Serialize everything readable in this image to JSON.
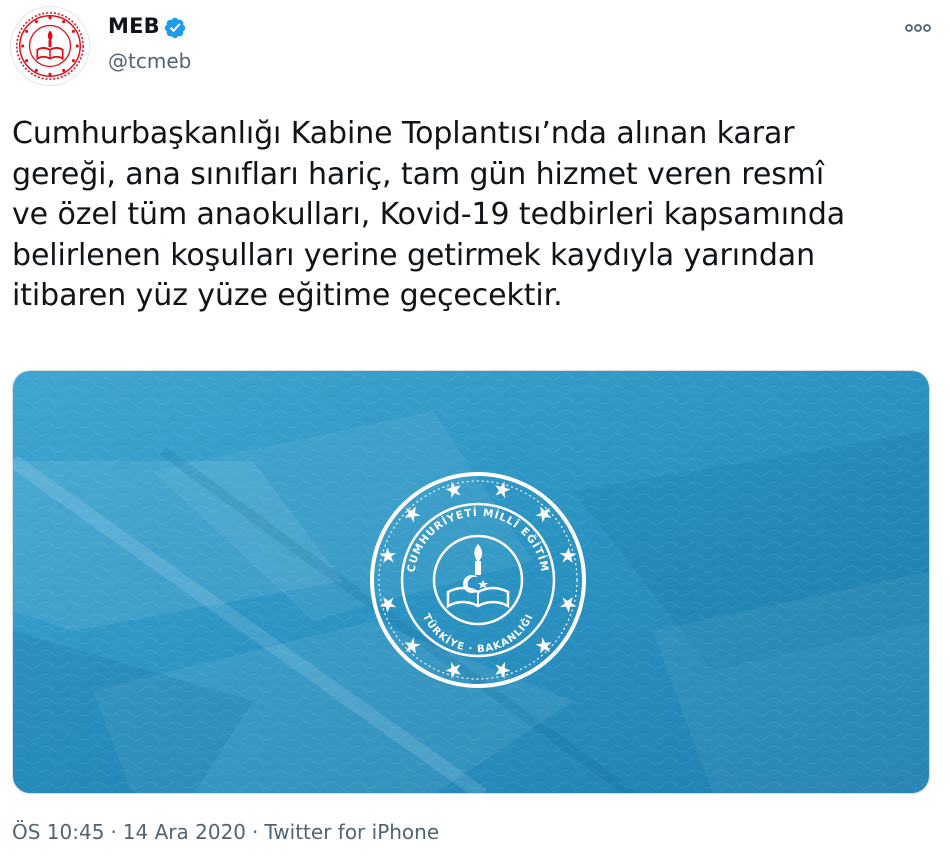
{
  "author": {
    "name": "MEB",
    "handle": "@tcmeb",
    "verified": true,
    "avatar_icon": "meb-logo-icon"
  },
  "menu": {
    "icon": "more-options-icon",
    "label": "ooo"
  },
  "tweet": {
    "text": "Cumhurbaşkanlığı Kabine Toplantısı’nda alınan karar\ngereği, ana sınıfları hariç, tam gün hizmet veren resmî\nve özel tüm anaokulları, Kovid-19 tedbirleri kapsamında\nbelirlenen koşulları yerine getirmek kaydıyla yarından\nitibaren yüz yüze eğitime geçecektir."
  },
  "media": {
    "seal_text": "TÜRKİYE CUMHURİYETİ MİLLÎ EĞİTİM BAKANLIĞI",
    "background_color": "#2e90bd",
    "seal_color": "#ffffff"
  },
  "meta": {
    "time": "ÖS 10:45",
    "separator": "·",
    "date": "14 Ara 2020",
    "source": "Twitter for iPhone"
  },
  "colors": {
    "text": "#0f1419",
    "secondary": "#536471",
    "verified": "#1d9bf0",
    "brand_red": "#e30a17"
  }
}
